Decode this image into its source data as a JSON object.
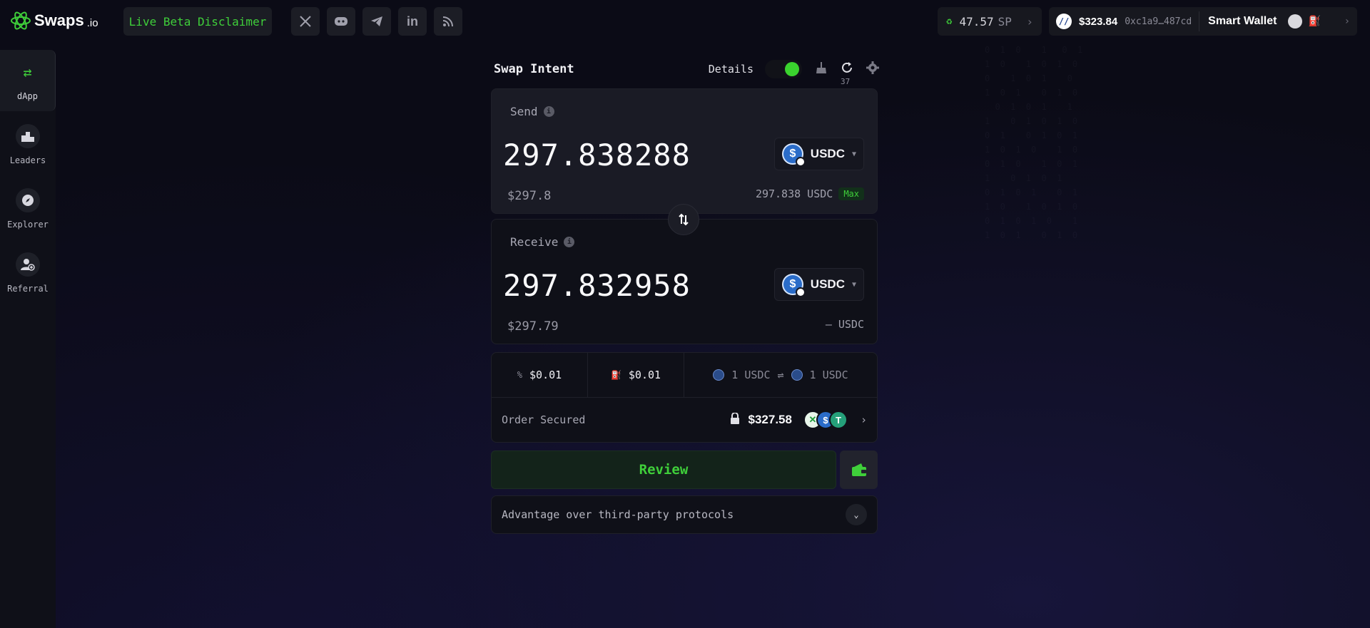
{
  "header": {
    "logo_text": "Swaps",
    "logo_suffix": ".io",
    "beta_label": "Live Beta Disclaimer",
    "social": [
      {
        "name": "x-icon",
        "glyph": "𝕏"
      },
      {
        "name": "discord-icon",
        "glyph": "◉"
      },
      {
        "name": "telegram-icon",
        "glyph": "➤"
      },
      {
        "name": "linkedin-icon",
        "glyph": "in"
      },
      {
        "name": "rss-icon",
        "glyph": "◔"
      }
    ],
    "sp_value": "47.57",
    "sp_unit": "SP",
    "wallet_balance": "$323.84",
    "wallet_address": "0xc1a9…487cd",
    "smart_wallet_label": "Smart Wallet"
  },
  "sidebar": {
    "items": [
      {
        "label": "dApp",
        "icon": "swap-arrows-icon",
        "active": true
      },
      {
        "label": "Leaders",
        "icon": "podium-icon",
        "active": false
      },
      {
        "label": "Explorer",
        "icon": "compass-icon",
        "active": false
      },
      {
        "label": "Referral",
        "icon": "add-user-icon",
        "active": false
      }
    ]
  },
  "main": {
    "title": "Swap Intent",
    "details_label": "Details",
    "refresh_count": "37",
    "send": {
      "label": "Send",
      "amount": "297.838288",
      "usd": "$297.8",
      "token": "USDC",
      "balance": "297.838 USDC",
      "max_label": "Max"
    },
    "receive": {
      "label": "Receive",
      "amount": "297.832958",
      "usd": "$297.79",
      "token": "USDC",
      "balance": "– USDC"
    },
    "fees": {
      "protocol_fee": "$0.01",
      "gas_fee": "$0.01",
      "rate_from": "1 USDC",
      "rate_to": "1 USDC"
    },
    "secured": {
      "label": "Order Secured",
      "amount": "$327.58"
    },
    "review_label": "Review",
    "advantage_label": "Advantage over third-party protocols"
  },
  "colors": {
    "accent": "#3fcf3a",
    "background": "#0b0b16",
    "panel": "#15161f"
  }
}
